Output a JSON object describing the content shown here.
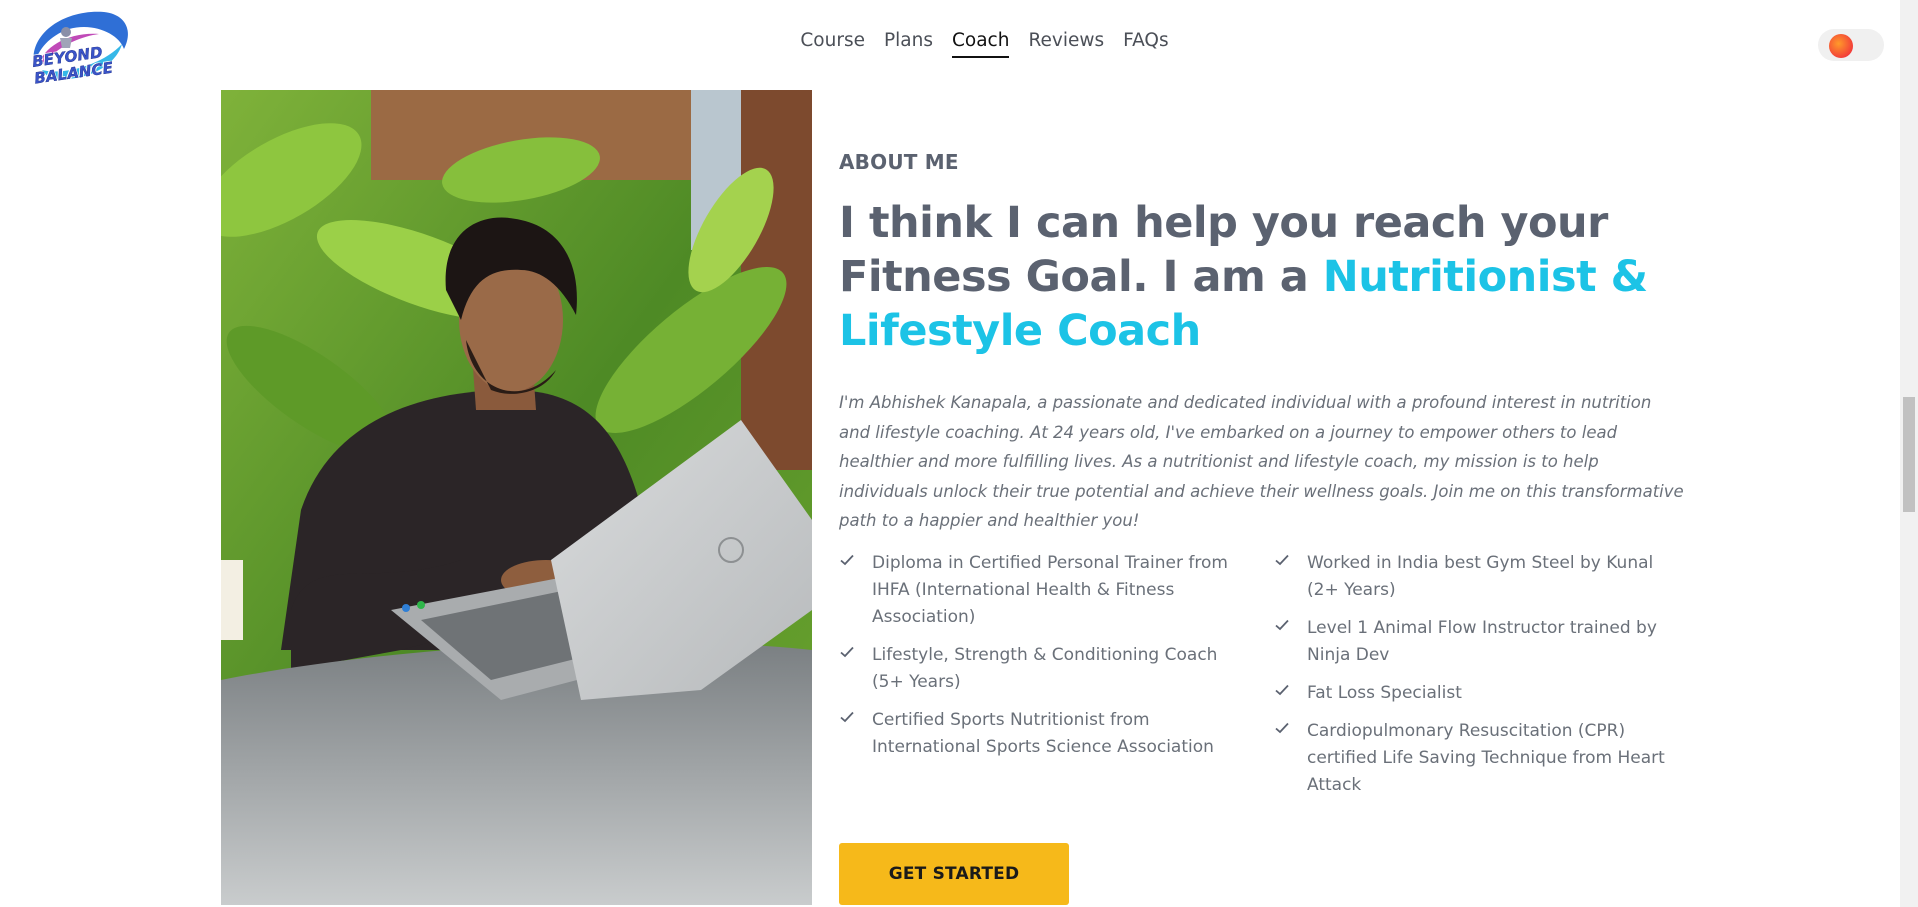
{
  "brand": {
    "logo_line1": "BEYOND",
    "logo_line2": "BALANCE"
  },
  "nav": {
    "items": [
      {
        "label": "Course"
      },
      {
        "label": "Plans"
      },
      {
        "label": "Coach",
        "active": true
      },
      {
        "label": "Reviews"
      },
      {
        "label": "FAQs"
      }
    ]
  },
  "theme_toggle": {
    "icon": "sun-toggle-icon",
    "state": "light"
  },
  "about": {
    "eyebrow": "ABOUT ME",
    "headline_plain": "I think I can help you reach your Fitness Goal. I am a ",
    "headline_accent": "Nutritionist & Lifestyle Coach",
    "bio": "I'm Abhishek Kanapala, a passionate and dedicated individual with a profound interest in nutrition and lifestyle coaching. At 24 years old, I've embarked on a journey to empower others to lead healthier and more fulfilling lives. As a nutritionist and lifestyle coach, my mission is to help individuals unlock their true potential and achieve their wellness goals. Join me on this transformative path to a happier and healthier you!",
    "credentials_left": [
      "Diploma in Certified Personal Trainer from IHFA (International Health & Fitness Association)",
      "Lifestyle, Strength & Conditioning Coach (5+ Years)",
      "Certified Sports Nutritionist from International Sports Science Association"
    ],
    "credentials_right": [
      "Worked in India best Gym Steel by Kunal (2+ Years)",
      "Level 1 Animal Flow Instructor trained by Ninja Dev",
      "Fat Loss Specialist",
      "Cardiopulmonary Resuscitation (CPR) certified Life Saving Technique from Heart Attack"
    ],
    "cta_label": "GET STARTED"
  },
  "colors": {
    "accent": "#1cc3e6",
    "cta": "#f6b91a",
    "text": "#5b6270"
  }
}
